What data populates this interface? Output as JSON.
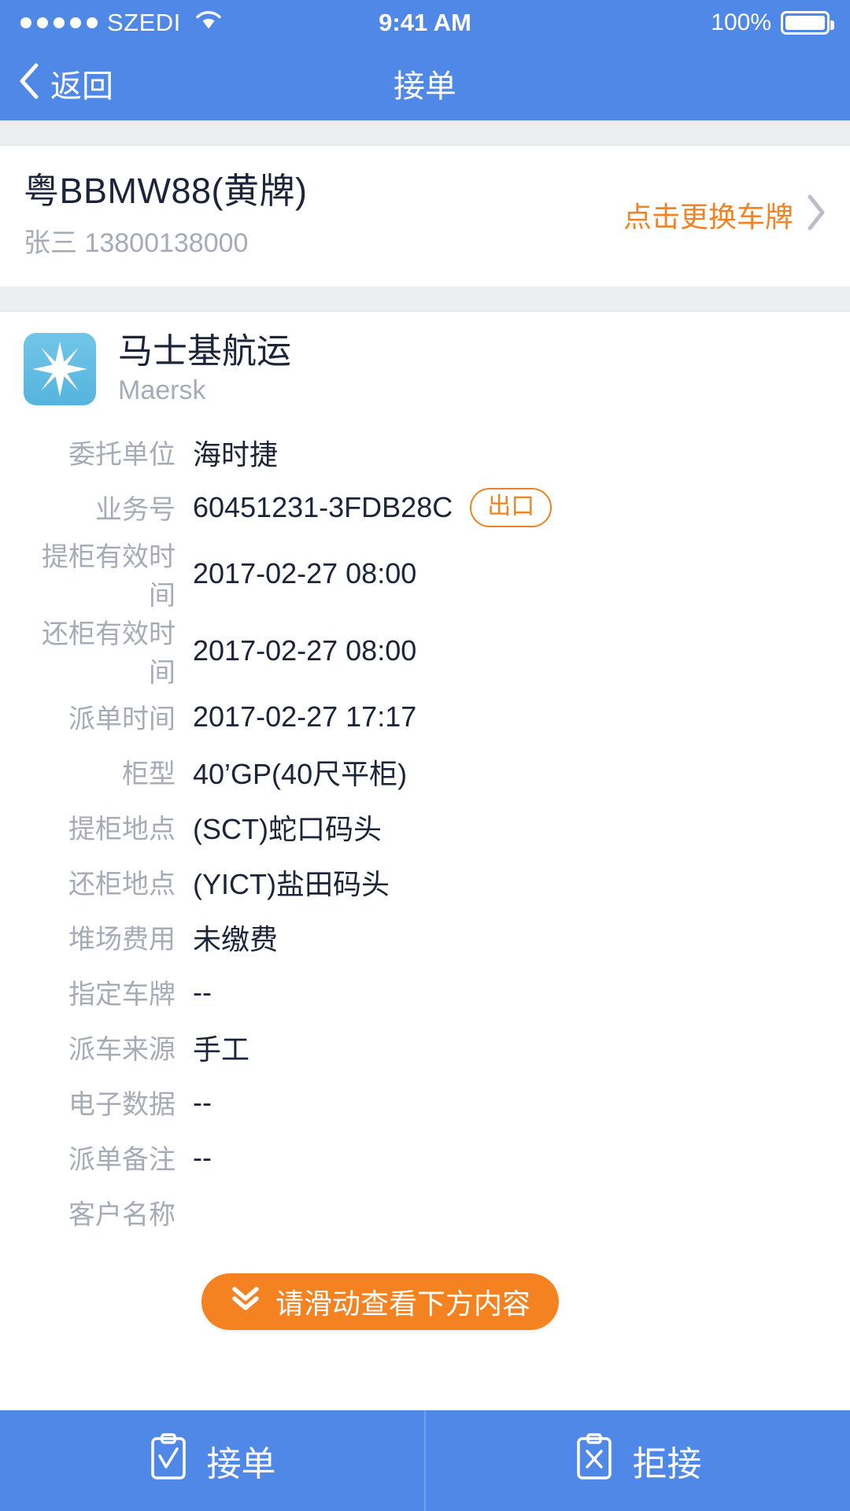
{
  "theme": {
    "primary": "#5088e8",
    "accent": "#f58220",
    "label_gray": "#a5acb8",
    "value_dark": "#1b2438"
  },
  "status_bar": {
    "carrier": "SZEDI",
    "signal_dots": 5,
    "wifi_icon": "wifi-icon",
    "time": "9:41 AM",
    "battery_percent": "100%",
    "battery_icon": "battery-full-icon"
  },
  "nav_bar": {
    "back_icon": "chevron-left-icon",
    "back_label": "返回",
    "title": "接单"
  },
  "vehicle": {
    "plate": "粤BBMW88(黄牌)",
    "driver_name": "张三",
    "driver_phone": "13800138000",
    "driver_line": "张三 13800138000",
    "change_plate_label": "点击更换车牌",
    "chevron_icon": "chevron-right-icon"
  },
  "company": {
    "logo_icon": "maersk-star-icon",
    "name_cn": "马士基航运",
    "name_en": "Maersk"
  },
  "details": {
    "rows": [
      {
        "label": "委托单位",
        "value": "海时捷",
        "badge": ""
      },
      {
        "label": "业务号",
        "value": "60451231-3FDB28C",
        "badge": "出口"
      },
      {
        "label": "提柜有效时间",
        "value": "2017-02-27 08:00",
        "badge": ""
      },
      {
        "label": "还柜有效时间",
        "value": "2017-02-27 08:00",
        "badge": ""
      },
      {
        "label": "派单时间",
        "value": "2017-02-27 17:17",
        "badge": ""
      },
      {
        "label": "柜型",
        "value": "40’GP(40尺平柜)",
        "badge": ""
      },
      {
        "label": "提柜地点",
        "value": "(SCT)蛇口码头",
        "badge": ""
      },
      {
        "label": "还柜地点",
        "value": "(YICT)盐田码头",
        "badge": ""
      },
      {
        "label": "堆场费用",
        "value": "未缴费",
        "badge": ""
      },
      {
        "label": "指定车牌",
        "value": "--",
        "badge": ""
      },
      {
        "label": "派车来源",
        "value": "手工",
        "badge": ""
      },
      {
        "label": "电子数据",
        "value": "--",
        "badge": ""
      },
      {
        "label": "派单备注",
        "value": "--",
        "badge": ""
      },
      {
        "label": "客户名称",
        "value": "",
        "badge": ""
      }
    ]
  },
  "scroll_hint": {
    "icon": "chevrons-down-icon",
    "label": "请滑动查看下方内容"
  },
  "action_bar": {
    "accept": {
      "icon": "clipboard-check-icon",
      "label": "接单"
    },
    "reject": {
      "icon": "clipboard-x-icon",
      "label": "拒接"
    }
  }
}
